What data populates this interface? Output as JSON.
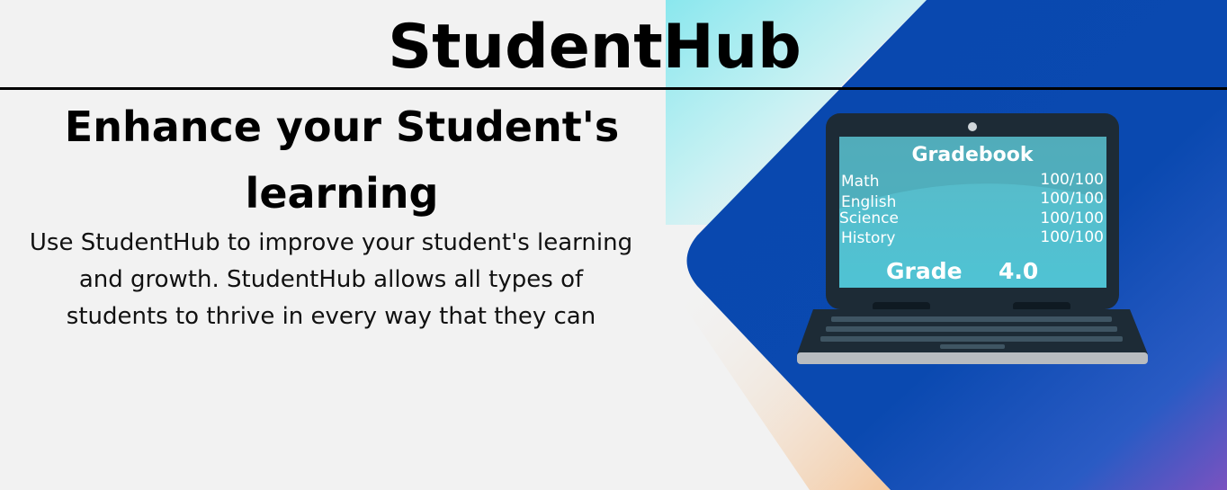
{
  "brand": {
    "title": "StudentHub"
  },
  "hero": {
    "headline": "Enhance your Student's learning",
    "body": "Use StudentHub to improve your student's learning and growth. StudentHub allows all types of students to thrive in every way that they can"
  },
  "gradebook": {
    "title": "Gradebook",
    "subjects": [
      {
        "name": "Math",
        "score": "100/100"
      },
      {
        "name": "English",
        "score": "100/100"
      },
      {
        "name": "Science",
        "score": "100/100"
      },
      {
        "name": "History",
        "score": "100/100"
      }
    ],
    "grade_label": "Grade",
    "grade_value": "4.0"
  },
  "colors": {
    "background": "#f2f2f2",
    "accent_blue": "#0a4bb1",
    "screen_teal": "#55bfcf",
    "laptop_dark": "#1d2b36"
  }
}
